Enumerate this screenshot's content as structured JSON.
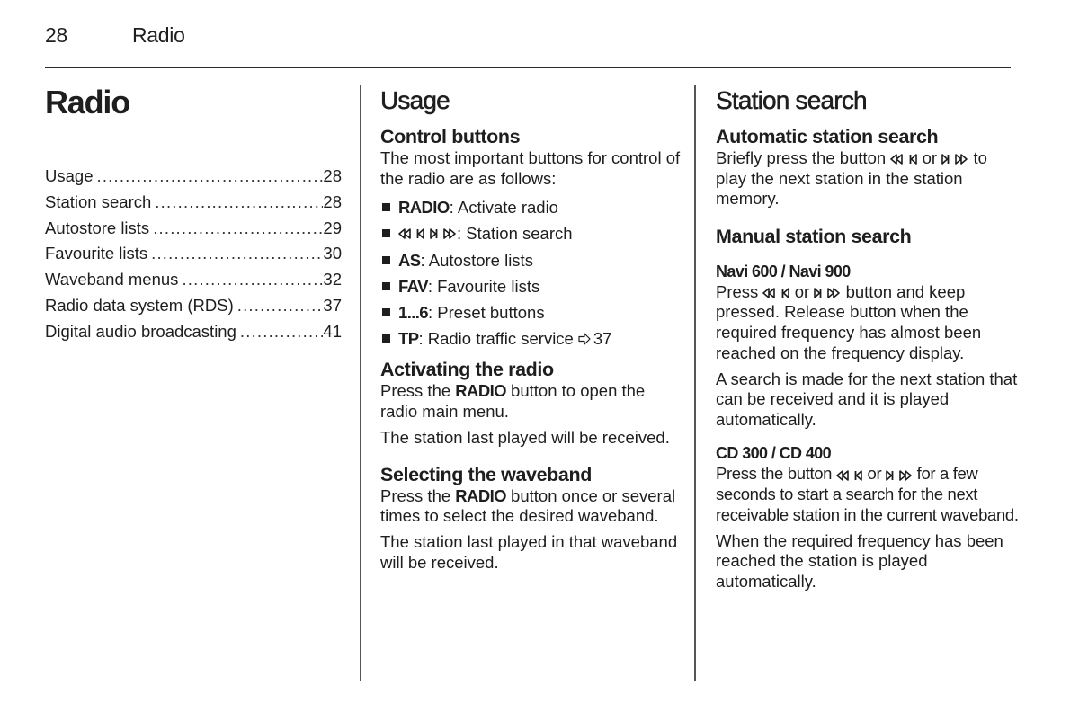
{
  "header": {
    "page_number": "28",
    "section_name": "Radio"
  },
  "sidebar": {
    "chapter_title": "Radio",
    "toc": [
      {
        "label": "Usage",
        "page": "28"
      },
      {
        "label": "Station search",
        "page": "28"
      },
      {
        "label": "Autostore lists",
        "page": "29"
      },
      {
        "label": "Favourite lists",
        "page": "30"
      },
      {
        "label": "Waveband menus",
        "page": "32"
      },
      {
        "label": "Radio data system (RDS)",
        "page": "37"
      },
      {
        "label": "Digital audio broadcasting",
        "page": "41"
      }
    ]
  },
  "usage": {
    "title": "Usage",
    "control_buttons": {
      "heading": "Control buttons",
      "intro": "The most important buttons for control of the radio are as follows:",
      "items": [
        {
          "key": "RADIO",
          "desc": ": Activate radio"
        },
        {
          "key_icons": [
            "fast-rewind-icon",
            "skip-previous-icon",
            "skip-next-icon",
            "fast-forward-icon"
          ],
          "desc": ": Station search"
        },
        {
          "key": "AS",
          "desc": ": Autostore lists"
        },
        {
          "key": "FAV",
          "desc": ": Favourite lists"
        },
        {
          "key": "1...6",
          "desc": ": Preset buttons"
        },
        {
          "key": "TP",
          "desc": ": Radio traffic service",
          "ref_icon": "page-reference-arrow-icon",
          "ref_page": "37"
        }
      ]
    },
    "activating": {
      "heading": "Activating the radio",
      "p1_pre": "Press the ",
      "p1_key": "RADIO",
      "p1_post": " button to open the radio main menu.",
      "p2": "The station last played will be received."
    },
    "waveband": {
      "heading": "Selecting the waveband",
      "p1_pre": "Press the ",
      "p1_key": "RADIO",
      "p1_post": " button once or several times to select the desired waveband.",
      "p2": "The station last played in that waveband will be received."
    }
  },
  "station_search": {
    "title": "Station search",
    "automatic": {
      "heading": "Automatic station search",
      "p1_pre": "Briefly press the button ",
      "p1_or": " or ",
      "p1_post": " to play the next station in the station memory."
    },
    "manual": {
      "heading": "Manual station search",
      "navi": {
        "heading": "Navi 600 / Navi 900",
        "p1_pre": "Press ",
        "p1_or": " or ",
        "p1_post": " button and keep pressed. Release button when the required frequency has almost been reached on the frequency display.",
        "p2": "A search is made for the next station that can be received and it is played automatically."
      },
      "cd": {
        "heading": "CD 300 / CD 400",
        "p1_pre": "Press the button ",
        "p1_or": " or ",
        "p1_post": " for a few seconds to start a search for the next receivable station in the current waveband.",
        "p2": "When the required frequency has been reached the station is played automatically."
      }
    }
  }
}
